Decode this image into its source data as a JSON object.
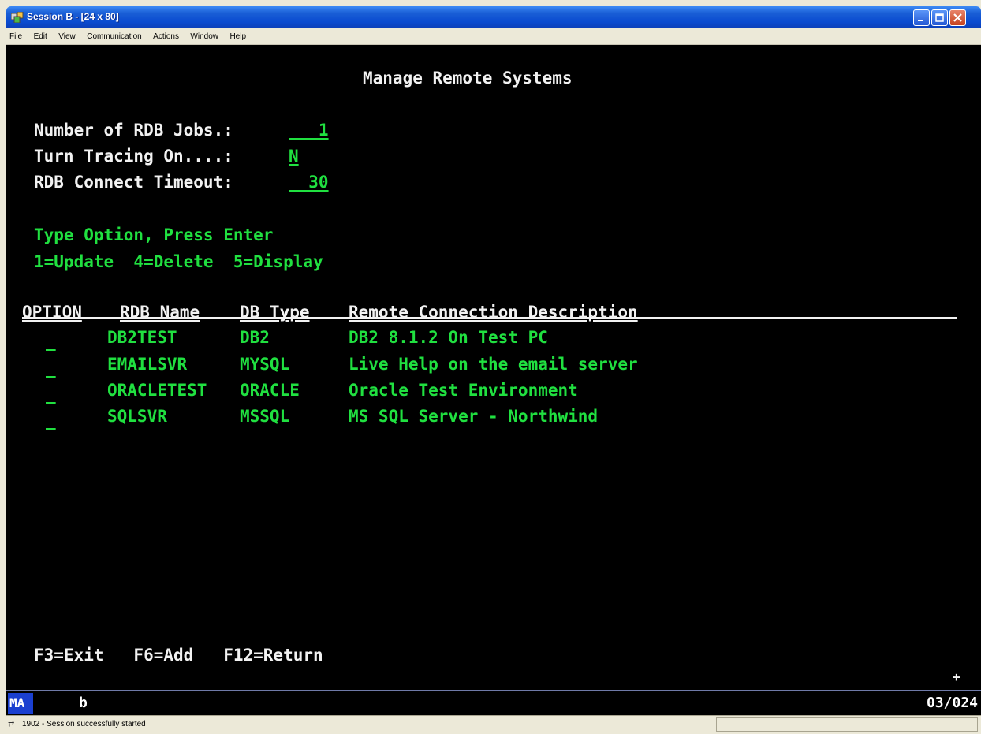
{
  "window": {
    "title": "Session B - [24 x 80]",
    "controls": {
      "minimize": "minimize",
      "maximize": "maximize",
      "close": "close"
    }
  },
  "menu": [
    "File",
    "Edit",
    "View",
    "Communication",
    "Actions",
    "Window",
    "Help"
  ],
  "screen": {
    "title": "Manage Remote Systems",
    "fields": [
      {
        "label": "Number of RDB Jobs.:",
        "value": "   1"
      },
      {
        "label": "Turn Tracing On....:",
        "value": "N"
      },
      {
        "label": "RDB Connect Timeout:",
        "value": "  30"
      }
    ],
    "instructions": "Type Option, Press Enter",
    "options": "1=Update  4=Delete  5=Display",
    "columns": [
      "OPTION",
      "RDB Name",
      "DB Type",
      "Remote Connection Description"
    ],
    "rows": [
      {
        "option": "_",
        "rdb_name": "DB2TEST",
        "db_type": "DB2",
        "description": "DB2 8.1.2 On Test PC"
      },
      {
        "option": "_",
        "rdb_name": "EMAILSVR",
        "db_type": "MYSQL",
        "description": "Live Help on the email server"
      },
      {
        "option": "_",
        "rdb_name": "ORACLETEST",
        "db_type": "ORACLE",
        "description": "Oracle Test Environment"
      },
      {
        "option": "_",
        "rdb_name": "SQLSVR",
        "db_type": "MSSQL",
        "description": "MS SQL Server - Northwind"
      }
    ],
    "function_keys": "F3=Exit   F6=Add   F12=Return",
    "more_indicator": "+"
  },
  "oia": {
    "mode": "MA",
    "field": "b",
    "cursor_position": "03/024"
  },
  "status": {
    "text": "1902 - Session successfully started"
  },
  "colors": {
    "field_text": "#20e040",
    "label_text": "#f2f2f2",
    "background": "#000000"
  }
}
